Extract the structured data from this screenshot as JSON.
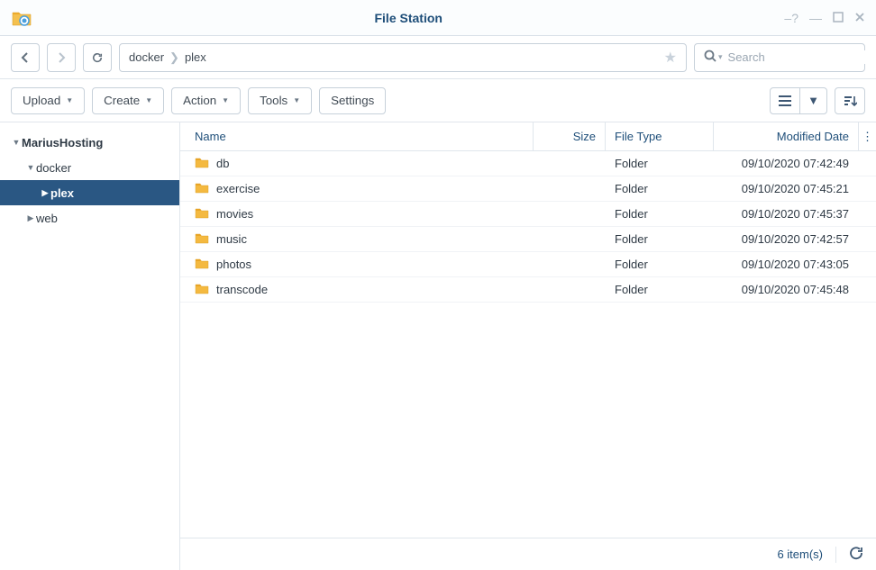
{
  "window": {
    "title": "File Station"
  },
  "path": {
    "segments": [
      "docker",
      "plex"
    ]
  },
  "search": {
    "placeholder": "Search"
  },
  "toolbar": {
    "upload": "Upload",
    "create": "Create",
    "action": "Action",
    "tools": "Tools",
    "settings": "Settings"
  },
  "sidebar": {
    "root": "MariusHosting",
    "items": [
      {
        "label": "docker",
        "expanded": true,
        "children": [
          {
            "label": "plex",
            "selected": true
          }
        ]
      },
      {
        "label": "web"
      }
    ]
  },
  "columns": {
    "name": "Name",
    "size": "Size",
    "type": "File Type",
    "modified": "Modified Date"
  },
  "files": [
    {
      "name": "db",
      "size": "",
      "type": "Folder",
      "modified": "09/10/2020 07:42:49"
    },
    {
      "name": "exercise",
      "size": "",
      "type": "Folder",
      "modified": "09/10/2020 07:45:21"
    },
    {
      "name": "movies",
      "size": "",
      "type": "Folder",
      "modified": "09/10/2020 07:45:37"
    },
    {
      "name": "music",
      "size": "",
      "type": "Folder",
      "modified": "09/10/2020 07:42:57"
    },
    {
      "name": "photos",
      "size": "",
      "type": "Folder",
      "modified": "09/10/2020 07:43:05"
    },
    {
      "name": "transcode",
      "size": "",
      "type": "Folder",
      "modified": "09/10/2020 07:45:48"
    }
  ],
  "status": {
    "count": "6 item(s)"
  }
}
